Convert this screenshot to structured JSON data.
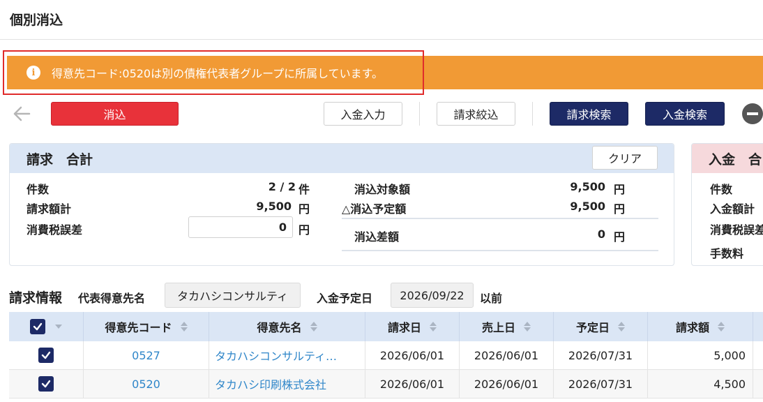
{
  "page": {
    "title": "個別消込"
  },
  "alert": {
    "message": "得意先コード:0520は別の債権代表者グループに所属しています。",
    "color": "#f19a35",
    "highlight_color": "#e02b2b"
  },
  "toolbar": {
    "keshikomi_label": "消込",
    "nyukin_input_label": "入金入力",
    "seikyu_filter_label": "請求絞込",
    "seikyu_search_label": "請求検索",
    "nyukin_search_label": "入金検索",
    "primary_color": "#e8323a",
    "navy_color": "#1d2a66"
  },
  "billing_summary": {
    "title": "請求　合計",
    "clear_label": "クリア",
    "count_label": "件数",
    "count_value": "2 / 2",
    "count_unit": "件",
    "amount_label": "請求額計",
    "amount_value": "9,500",
    "amount_unit": "円",
    "tax_error_label": "消費税誤差",
    "tax_error_value": "0",
    "tax_error_unit": "円",
    "target_label": "消込対象額",
    "target_value": "9,500",
    "target_unit": "円",
    "planned_label": "△消込予定額",
    "planned_value": "9,500",
    "planned_unit": "円",
    "diff_label": "消込差額",
    "diff_value": "0",
    "diff_unit": "円"
  },
  "payment_summary": {
    "title": "入金　合",
    "count_label": "件数",
    "amount_label": "入金額計",
    "tax_error_label": "消費税誤差",
    "fee_label": "手数料"
  },
  "billing_info": {
    "title": "請求情報",
    "rep_customer_label": "代表得意先名",
    "rep_customer_value": "タカハシコンサルティ",
    "payment_date_label": "入金予定日",
    "payment_date_value": "2026/09/22",
    "payment_date_suffix": "以前"
  },
  "table": {
    "columns": [
      "得意先コード",
      "得意先名",
      "請求日",
      "売上日",
      "予定日",
      "請求額"
    ],
    "rows": [
      {
        "code": "0527",
        "name": "タカハシコンサルティ…",
        "bill_date": "2026/06/01",
        "sale_date": "2026/06/01",
        "due_date": "2026/07/31",
        "amount": "5,000"
      },
      {
        "code": "0520",
        "name": "タカハシ印刷株式会社",
        "bill_date": "2026/06/01",
        "sale_date": "2026/06/01",
        "due_date": "2026/07/31",
        "amount": "4,500"
      }
    ]
  }
}
